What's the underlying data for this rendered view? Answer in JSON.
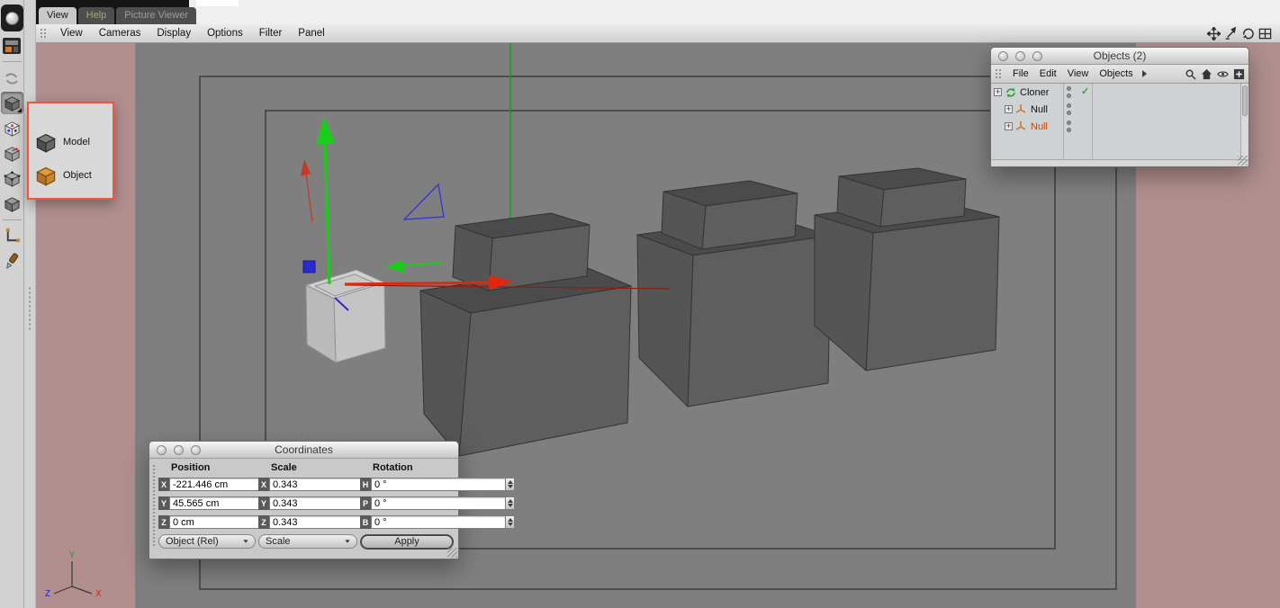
{
  "colors": {
    "accent": "#f4543d",
    "workspace-bg": "#b18f8f",
    "viewport-bg": "#7f7f7f",
    "cloner-green": "#2da12d",
    "selected-text": "#c84400"
  },
  "tabs": [
    {
      "label": "View"
    },
    {
      "label": "Help"
    },
    {
      "label": "Picture Viewer"
    }
  ],
  "menubar": {
    "items": [
      "View",
      "Cameras",
      "Display",
      "Options",
      "Filter",
      "Panel"
    ]
  },
  "tool_flyout": {
    "items": [
      {
        "label": "Model"
      },
      {
        "label": "Object"
      }
    ]
  },
  "objects_window": {
    "title": "Objects (2)",
    "menu": [
      "File",
      "Edit",
      "View",
      "Objects"
    ],
    "tree": [
      {
        "label": "Cloner",
        "check": "✓"
      },
      {
        "label": "Null"
      },
      {
        "label": "Null"
      }
    ]
  },
  "coordinates_window": {
    "title": "Coordinates",
    "headers": {
      "position": "Position",
      "scale": "Scale",
      "rotation": "Rotation"
    },
    "rows": [
      {
        "pos_label": "X",
        "pos_value": "-221.446 cm",
        "scale_label": "X",
        "scale_value": "0.343",
        "rot_label": "H",
        "rot_value": "0 °"
      },
      {
        "pos_label": "Y",
        "pos_value": "45.565 cm",
        "scale_label": "Y",
        "scale_value": "0.343",
        "rot_label": "P",
        "rot_value": "0 °"
      },
      {
        "pos_label": "Z",
        "pos_value": "0 cm",
        "scale_label": "Z",
        "scale_value": "0.343",
        "rot_label": "B",
        "rot_value": "0 °"
      }
    ],
    "position_mode": "Object (Rel)",
    "scale_mode": "Scale",
    "apply_label": "Apply"
  },
  "axis_indicator": {
    "x": "X",
    "y": "Y",
    "z": "Z"
  },
  "icons": {
    "expander_plus": "+"
  }
}
